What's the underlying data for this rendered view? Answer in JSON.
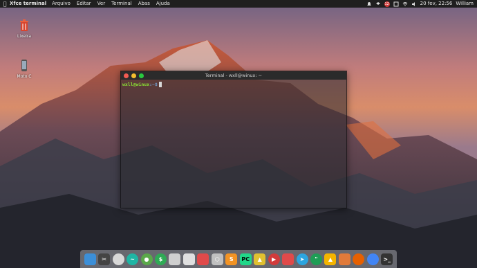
{
  "topbar": {
    "app_title": "Xfce terminal",
    "menus": [
      "Arquivo",
      "Editar",
      "Ver",
      "Terminal",
      "Abas",
      "Ajuda"
    ],
    "notification_count": "12",
    "datetime": "20 fev, 22:56",
    "user": "William"
  },
  "desktop": {
    "icons": [
      {
        "label": "Lixeira",
        "icon": "trash-icon"
      },
      {
        "label": "Moto C",
        "icon": "phone-icon"
      }
    ]
  },
  "terminal": {
    "title": "Terminal - wxll@winux: ~",
    "prompt_user": "wxll@winux",
    "prompt_path": ":~$"
  },
  "dock": {
    "items": [
      {
        "name": "file-manager-icon",
        "color": "#3c8fd8"
      },
      {
        "name": "scissors-icon",
        "color": "#444444"
      },
      {
        "name": "clock-icon",
        "color": "#d8d8d8"
      },
      {
        "name": "system-monitor-icon",
        "color": "#1fb5a4"
      },
      {
        "name": "location-icon",
        "color": "#5aa84a"
      },
      {
        "name": "dollar-icon",
        "color": "#2faa55"
      },
      {
        "name": "disk-icon",
        "color": "#cfcfcf"
      },
      {
        "name": "media-icon",
        "color": "#e0e0e0"
      },
      {
        "name": "mail-icon",
        "color": "#e04a4a"
      },
      {
        "name": "hexagon-icon",
        "color": "#c0c0c0"
      },
      {
        "name": "sublime-icon",
        "color": "#f29324"
      },
      {
        "name": "pycharm-icon",
        "color": "#21d789"
      },
      {
        "name": "shapes-icon",
        "color": "#e0c030"
      },
      {
        "name": "music-player-icon",
        "color": "#d23b3b"
      },
      {
        "name": "bookmark-icon",
        "color": "#e04a4a"
      },
      {
        "name": "telegram-icon",
        "color": "#2ca5e0"
      },
      {
        "name": "hangouts-icon",
        "color": "#1f9d55"
      },
      {
        "name": "drive-icon",
        "color": "#f4b400"
      },
      {
        "name": "box-icon",
        "color": "#e07a3a"
      },
      {
        "name": "firefox-icon",
        "color": "#e66000"
      },
      {
        "name": "chrome-icon",
        "color": "#4285f4"
      },
      {
        "name": "terminal-icon",
        "color": "#333333"
      }
    ]
  }
}
